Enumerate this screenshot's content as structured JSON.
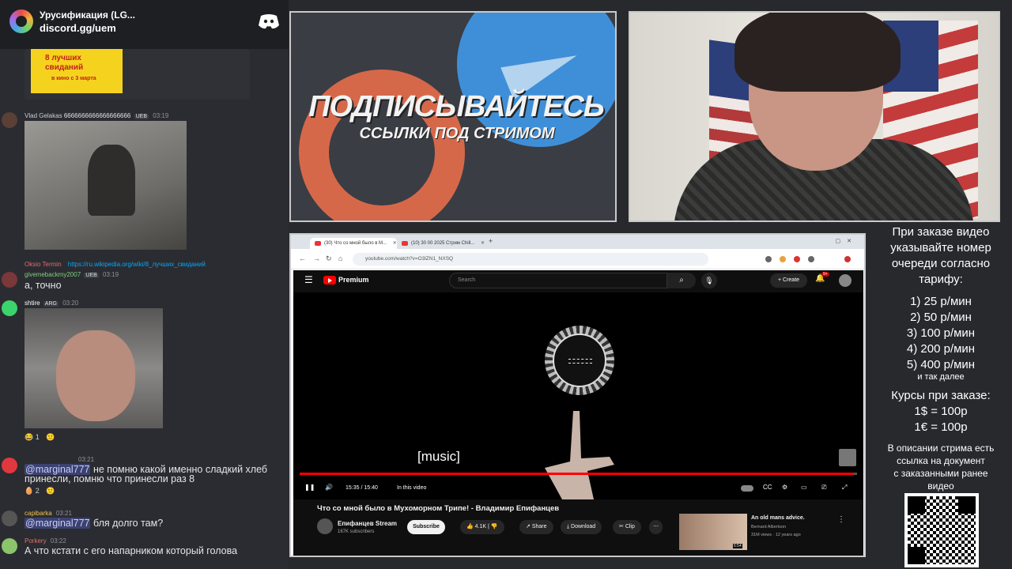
{
  "discord": {
    "server_name": "Урусификация (LG...",
    "invite": "discord.gg/uem",
    "poster": {
      "line1": "8 лучших",
      "line2": "свиданий",
      "line3": "в кино с 3 марта"
    },
    "messages": [
      {
        "user": "Vlad Gelakas",
        "text_inline": "6666666666666666666",
        "badge": "UEB",
        "time": "03:19"
      },
      {
        "user": "Oksio Termin",
        "link": "https://ru.wikipedia.org/wiki/8_лучших_свиданий"
      },
      {
        "user": "givemebackmy2007",
        "badge": "UEB",
        "time": "03:19",
        "text": "а, точно"
      },
      {
        "user": "shtire",
        "badge": "ARG",
        "time": "03:20",
        "reactions": [
          "😂 1",
          "🙂"
        ]
      },
      {
        "time": "03:21",
        "mention": "@marginal777",
        "text": "не помню какой именно сладкий хлеб",
        "text2": "принесли, помню что принесли раз 8",
        "reactions": [
          "🥚 2",
          "🙂"
        ]
      },
      {
        "user": "capibarka",
        "time": "03:21",
        "mention": "@marginal777",
        "text": "бля долго там?"
      },
      {
        "user": "Porkery",
        "time": "03:22",
        "text": "А что кстати с его напарником который голова"
      }
    ]
  },
  "banner": {
    "title": "ПОДПИСЫВАЙТЕСЬ",
    "subtitle": "ССЫЛКИ ПОД СТРИМОМ"
  },
  "browser": {
    "tab1": "(30) Что со мной было в М...",
    "tab2": "(10) 30 00 2025 Стрим Chill...",
    "url": "youtube.com/watch?v=O3lZN1_NXSQ"
  },
  "youtube": {
    "brand": "Premium",
    "search_placeholder": "Search",
    "create_label": "Create",
    "notif_count": "9+",
    "caption": "[music]",
    "time": "15:35 / 15:40",
    "chapter": "In this video",
    "progress": 0.995,
    "video_title": "Что со мной было в Мухоморном Трипе! - Владимир Епифанцев",
    "channel": "Епифанцев Stream",
    "subscribers": "167K subscribers",
    "subscribe_label": "Subscribe",
    "likes": "4.1K",
    "share_label": "Share",
    "download_label": "Download",
    "clip_label": "Clip",
    "rec": {
      "title": "An old mans advice.",
      "channel": "Bernard Albertson",
      "meta": "31M views · 12 years ago",
      "duration": "6:54"
    }
  },
  "panel": {
    "order_l1": "При заказе видео",
    "order_l2": "указывайте номер",
    "order_l3": "очереди согласно",
    "order_l4": "тарифу:",
    "tariffs": [
      "1) 25 р/мин",
      "2) 50 р/мин",
      "3) 100 р/мин",
      "4) 200 р/мин",
      "5) 400 р/мин"
    ],
    "and_more": "и так далее",
    "rates_title": "Курсы при заказе:",
    "rate_usd": "1$ = 100р",
    "rate_eur": "1€ = 100р",
    "desc_l1": "В описании стрима есть",
    "desc_l2": "ссылка на документ",
    "desc_l3": "с заказанными ранее",
    "desc_l4": "видео"
  }
}
